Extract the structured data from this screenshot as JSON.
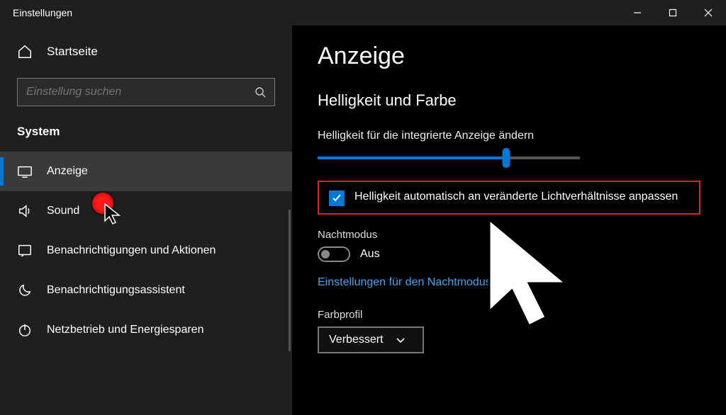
{
  "window": {
    "title": "Einstellungen"
  },
  "sidebar": {
    "home_label": "Startseite",
    "search_placeholder": "Einstellung suchen",
    "section_label": "System",
    "items": [
      {
        "label": "Anzeige",
        "active": true
      },
      {
        "label": "Sound",
        "active": false
      },
      {
        "label": "Benachrichtigungen und Aktionen",
        "active": false
      },
      {
        "label": "Benachrichtigungsassistent",
        "active": false
      },
      {
        "label": "Netzbetrieb und Energiesparen",
        "active": false
      }
    ]
  },
  "main": {
    "page_title": "Anzeige",
    "section_title": "Helligkeit und Farbe",
    "brightness_label": "Helligkeit für die integrierte Anzeige ändern",
    "brightness_percent": 72,
    "auto_brightness_label": "Helligkeit automatisch an veränderte Lichtverhältnisse anpassen",
    "auto_brightness_checked": true,
    "nightmode_label": "Nachtmodus",
    "nightmode_state": "Aus",
    "nightmode_link": "Einstellungen für den Nachtmodus",
    "colorprofile_label": "Farbprofil",
    "colorprofile_value": "Verbessert"
  },
  "colors": {
    "accent": "#0078d4",
    "highlight": "#d22",
    "link": "#4aa3e8"
  }
}
